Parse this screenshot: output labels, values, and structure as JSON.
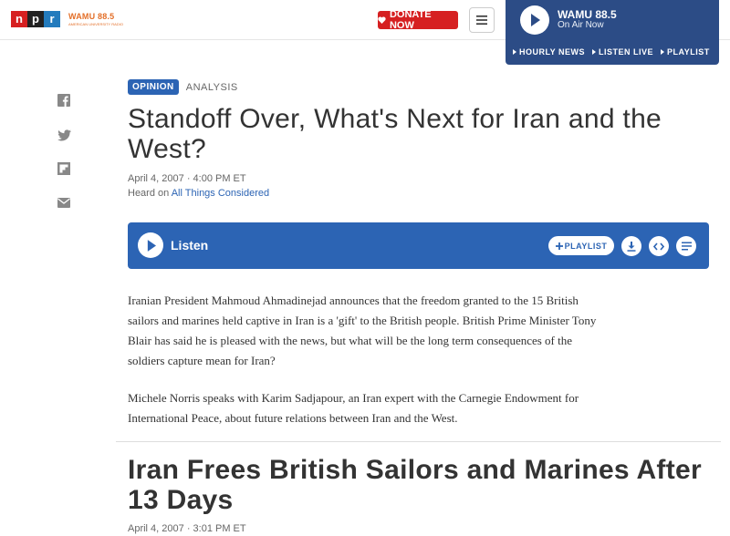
{
  "header": {
    "logo": [
      "n",
      "p",
      "r"
    ],
    "station_logo": "WAMU 88.5",
    "station_tagline": "AMERICAN UNIVERSITY RADIO",
    "donate_label": "DONATE NOW",
    "menu_icon": "hamburger-icon"
  },
  "player": {
    "station": "WAMU 88.5",
    "status": "On Air Now",
    "links": [
      "HOURLY NEWS",
      "LISTEN LIVE",
      "PLAYLIST"
    ]
  },
  "share": [
    "facebook-icon",
    "twitter-icon",
    "flipboard-icon",
    "email-icon"
  ],
  "article": {
    "tag_primary": "OPINION",
    "tag_secondary": "ANALYSIS",
    "headline": "Standoff Over, What's Next for Iran and the West?",
    "dateline": "April 4, 2007 · 4:00 PM ET",
    "heard_on_prefix": "Heard on ",
    "heard_on_show": "All Things Considered",
    "listen_label": "Listen",
    "playlist_label": "PLAYLIST",
    "paragraphs": [
      "Iranian President Mahmoud Ahmadinejad announces that the freedom granted to the 15 British sailors and marines held captive in Iran is a 'gift' to the British people. British Prime Minister Tony Blair has said he is pleased with the news, but what will be the long term consequences of the soldiers capture mean for Iran?",
      "Michele Norris speaks with Karim Sadjapour, an Iran expert with the Carnegie Endowment for International Peace, about future relations between Iran and the West."
    ]
  },
  "next_article": {
    "headline": "Iran Frees British Sailors and Marines After 13 Days",
    "dateline": "April 4, 2007 · 3:01 PM ET"
  },
  "colors": {
    "npr_red": "#d62021",
    "npr_blue": "#237bbd",
    "player_navy": "#2c4c86",
    "accent_blue": "#2c64b4",
    "wamu_orange": "#e36e27"
  }
}
